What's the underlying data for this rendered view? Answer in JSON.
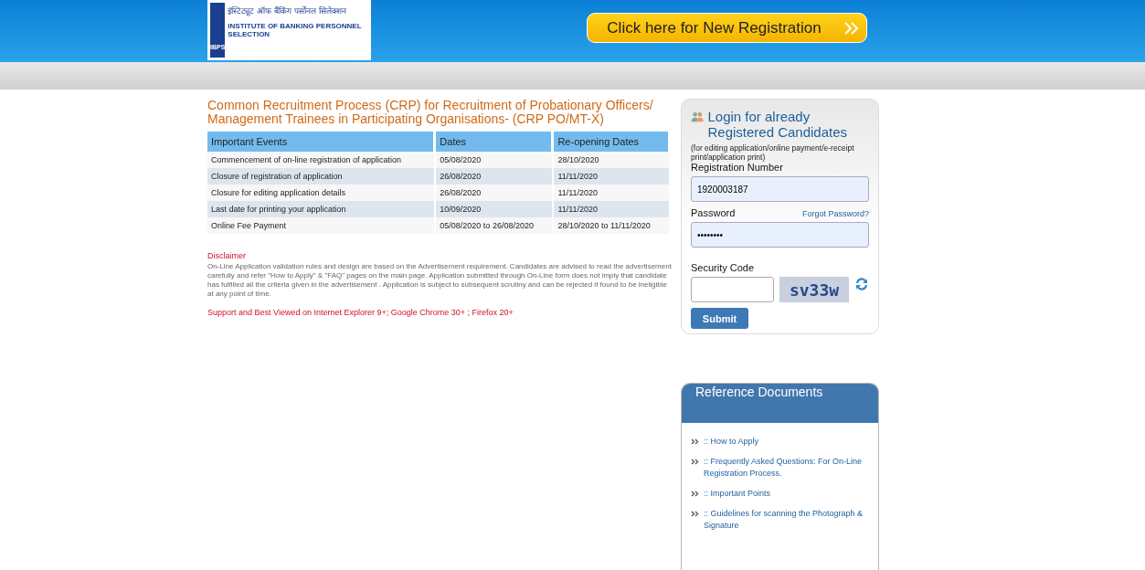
{
  "header": {
    "logo": {
      "hindi_title": "इंस्टिट्यूट ऑफ बैंकिंग पर्सोनल सिलेक्शन",
      "title": "INSTITUTE OF BANKING PERSONNEL SELECTION",
      "mark": "IBPS"
    },
    "registration_button": "Click here for New Registration"
  },
  "main": {
    "title": "Common Recruitment Process (CRP) for Recruitment of Probationary Officers/ Management Trainees in Participating Organisations- (CRP PO/MT-X)",
    "table": {
      "columns": [
        "Important Events",
        "Dates",
        "Re-opening Dates"
      ],
      "rows": [
        [
          "Commencement of on-line registration of application",
          "05/08/2020",
          "28/10/2020"
        ],
        [
          "Closure of registration of application",
          "26/08/2020",
          "11/11/2020"
        ],
        [
          "Closure for editing application details",
          "26/08/2020",
          "11/11/2020"
        ],
        [
          "Last date for printing your application",
          "10/09/2020",
          "11/11/2020"
        ],
        [
          "Online Fee Payment",
          "05/08/2020 to 26/08/2020",
          "28/10/2020 to 11/11/2020"
        ]
      ]
    },
    "disclaimer_title": "Disclaimer",
    "disclaimer": "On-Line Application validation rules and design are based on the Advertisement requirement. Candidates are advised to read the advertisement carefully and refer \"How to Apply\" & \"FAQ\" pages on the main page. Application submitted through On-Line form does not imply that candidate has fulfilled all the criteria given in the advertisement . Application is subject to subsequent scrutiny and can be rejected if found to be ineligible at any point of time.",
    "browser_note": "Support and Best Viewed on Internet Explorer 9+; Google Chrome 30+ ; Firefox 20+"
  },
  "login": {
    "title": "Login for already Registered Candidates",
    "subtitle": "(for editing application/online payment/e-receipt print/application print)",
    "registration_label": "Registration Number",
    "registration_value": "1920003187",
    "password_label": "Password",
    "forgot_link": "Forgot Password?",
    "password_value": "••••••••",
    "security_label": "Security Code",
    "captcha": "sv33w",
    "submit": "Submit"
  },
  "reference": {
    "title": "Reference Documents",
    "items": [
      ":: How to Apply",
      ":: Frequently Asked Questions: For On-Line Registration Process.",
      ":: Important Points",
      ":: Guidelines for scanning the Photograph & Signature"
    ]
  }
}
